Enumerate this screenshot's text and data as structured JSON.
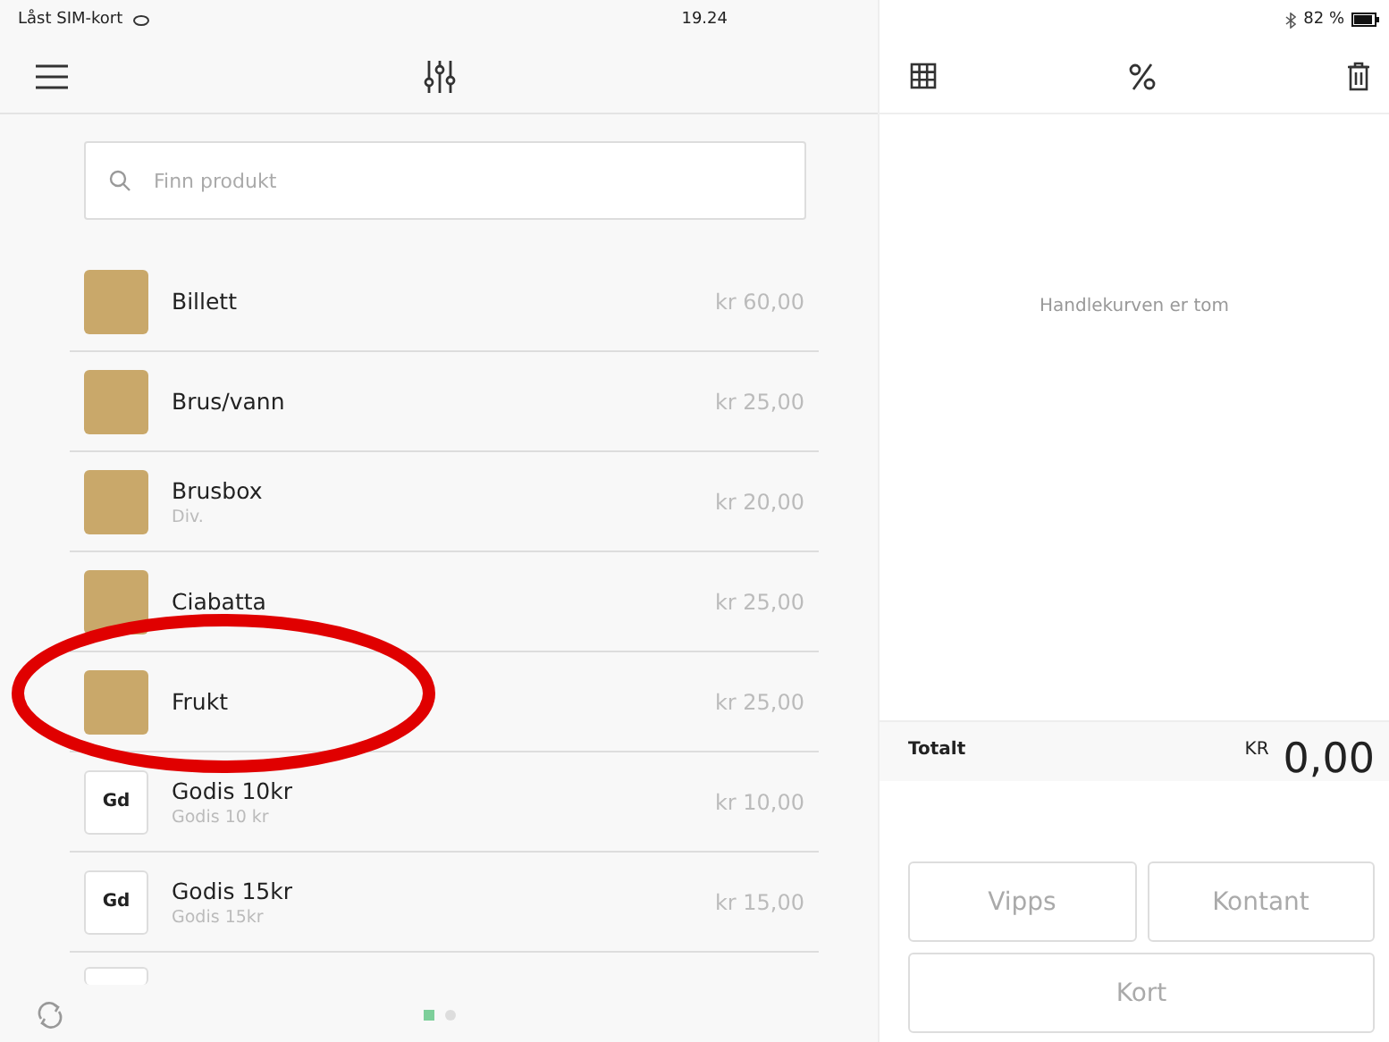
{
  "status_bar": {
    "carrier": "Låst SIM-kort",
    "time": "19.24",
    "battery": "82 %"
  },
  "search": {
    "placeholder": "Finn produkt"
  },
  "products": [
    {
      "name": "Billett",
      "price": "kr 60,00",
      "kind": "photo"
    },
    {
      "name": "Brus/vann",
      "price": "kr 25,00",
      "kind": "photo"
    },
    {
      "name": "Brusbox",
      "subtitle": "Div.",
      "price": "kr 20,00",
      "kind": "photo"
    },
    {
      "name": "Ciabatta",
      "price": "kr 25,00",
      "kind": "photo"
    },
    {
      "name": "Frukt",
      "price": "kr 25,00",
      "kind": "photo"
    },
    {
      "name": "Godis 10kr",
      "subtitle": "Godis 10 kr",
      "price": "kr 10,00",
      "kind": "initials",
      "initials": "Gd"
    },
    {
      "name": "Godis 15kr",
      "subtitle": "Godis 15kr",
      "price": "kr 15,00",
      "kind": "initials",
      "initials": "Gd"
    }
  ],
  "pages": [
    {
      "selected": true
    },
    {
      "selected": false
    }
  ],
  "cart": {
    "empty_message": "Handlekurven er tom",
    "total_label": "Totalt",
    "currency": "KR",
    "total": "0,00"
  },
  "payment_buttons": [
    "Vipps",
    "Kontant",
    "Kort"
  ]
}
